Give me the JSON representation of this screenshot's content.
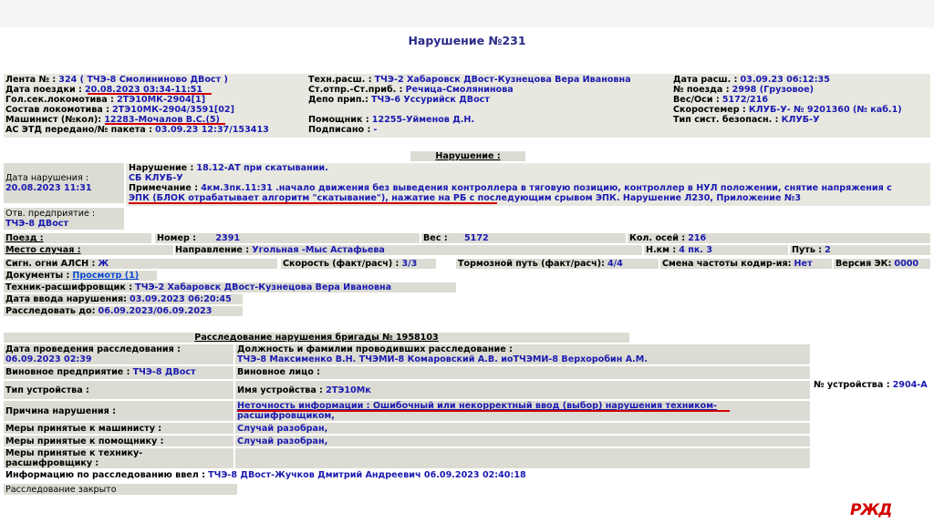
{
  "title": "Нарушение №231",
  "info": {
    "lenta_label": "Лента № :",
    "lenta_value": "324 ( ТЧЭ-8 Смолининово ДВост )",
    "trip_date_label": "Дата поездки :",
    "trip_date_value": "20.08.2023 03:34-11:51",
    "lead_loco_label": "Гол.сек.локомотива :",
    "lead_loco_value": "2ТЭ10МК-2904[1]",
    "loco_comp_label": "Состав локомотива :",
    "loco_comp_value": "2ТЭ10МК-2904/3591[02]",
    "driver_label": "Машинист (№кол):",
    "driver_value": "12283-Мочалов В.С.(5)",
    "asetd_label": "АС ЭТД передано/№ пакета :",
    "asetd_value": "03.09.23 12:37/153413",
    "tech_label": "Техн.расш. :",
    "tech_value": "ТЧЭ-2 Хабаровск ДВост-Кузнецова Вера Ивановна",
    "stations_label": "Ст.отпр.-Ст.приб. :",
    "stations_value": "Речица-Смолянинова",
    "depot_label": "Депо прип.:",
    "depot_value": "ТЧЭ-6 Уссурийск ДВост",
    "assistant_label": "Помощник :",
    "assistant_value": "12255-Уйменов Д.Н.",
    "signed_label": "Подписано :",
    "signed_value": "-",
    "decode_date_label": "Дата расш. :",
    "decode_date_value": "03.09.23 06:12:35",
    "train_no_label": "№ поезда :",
    "train_no_value": "2998 (Грузовое)",
    "weight_label": "Вес/Оси :",
    "weight_value": "5172/216",
    "speedometer_label": "Скоростемер :",
    "speedometer_value": "КЛУБ-У- № 9201360 (№ каб.1)",
    "safety_label": "Тип сист. безопасн. :",
    "safety_value": "КЛУБ-У"
  },
  "violation": {
    "section_header": "Нарушение :",
    "date_label": "Дата нарушения :",
    "date_value": "20.08.2023 11:31",
    "resp_label": "Отв. предприятие :",
    "resp_value": "ТЧЭ-8 ДВост",
    "name_label": "Нарушение :",
    "name_value": "18.12-АТ при скатывании.",
    "system_value": "СБ КЛУБ-У",
    "note_label": "Примечание :",
    "note_value_1": "4км.3пк.11:31 .начало движения без выведения контроллера в тяговую позицию, контроллер в НУЛ положении, снятие напряжения с",
    "note_value_2": "ЭПК (БЛОК отрабатывает алгоритм \"скатывание\"), нажатие на РБ с последующим срывом ЭПК. Нарушение Л230, Приложение №3"
  },
  "train": {
    "train_label": "Поезд :",
    "number_label": "Номер :",
    "number_value": "2391",
    "weight_label": "Вес :",
    "weight_value": "5172",
    "axles_label": "Кол. осей :",
    "axles_value": "216",
    "place_label": "Место случая :",
    "direction_label": "Направление :",
    "direction_value": "Угольная -Мыс Астафьева",
    "km_label": "Н.км :",
    "km_value": "4 пк. 3",
    "track_label": "Путь :",
    "track_value": "2",
    "alsn_label": "Сигн. огни АЛСН :",
    "alsn_value": "Ж",
    "speed_label": "Скорость (факт/расч) :",
    "speed_value": "3/3",
    "brake_label": "Тормозной путь (факт/расч):",
    "brake_value": "4/4",
    "freq_label": "Смена частоты кодир-ия:",
    "freq_value": "Нет",
    "version_label": "Версия ЭК:",
    "version_value": "0000",
    "docs_label": "Документы :",
    "docs_link": "Просмотр (1)",
    "decoder_label": "Техник-расшифровщик :",
    "decoder_value": "ТЧЭ-2 Хабаровск ДВост-Кузнецова Вера Ивановна",
    "entry_label": "Дата ввода нарушения:",
    "entry_value": "03.09.2023 06:20:45",
    "investigate_label": "Расследовать до:",
    "investigate_value": "06.09.2023/06.09.2023"
  },
  "investigation": {
    "section_header": "Расследование нарушения бригады № 1958103",
    "date_label": "Дата проведения расследования :",
    "date_value": "06.09.2023  02:39",
    "positions_label": "Должность и фамилии проводивших расследование :",
    "positions_value": "ТЧЭ-8 Максименко В.Н. ТЧЭМИ-8 Комаровский А.В. иоТЧЭМИ-8 Верхоробин А.М.",
    "guilty_ent_label": "Виновное предприятие :",
    "guilty_ent_value": "ТЧЭ-8 ДВост",
    "guilty_person_label": "Виновное лицо :",
    "device_type_label": "Тип устройства :",
    "device_name_label": "Имя устройства :",
    "device_name_value": "2ТЭ10Мк",
    "device_no_label": "№ устройства :",
    "device_no_value": "2904-А",
    "cause_label": "Причина нарушения :",
    "cause_value_1": "Неточность информации : Ошибочный или некорректный ввод (выбор) нарушения техником-",
    "cause_value_2": "расшифровщиком,",
    "measures_driver_label": "Меры принятые к машинисту :",
    "measures_driver_value": "Случай разобран,",
    "measures_assistant_label": "Меры принятые к помощнику :",
    "measures_assistant_value": "Случай разобран,",
    "measures_tech_label_1": "Меры принятые к технику-",
    "measures_tech_label_2": "расшифровщику :",
    "info_label": "Информацию по расследованию ввел :",
    "info_value": "ТЧЭ-8 ДВост-Жучков Дмитрий Андреевич 06.09.2023 02:40:18",
    "closed_label": "Расследование закрыто"
  },
  "logo_text": "РЖД",
  "colors": {
    "label_bg": "#dcdcd4",
    "value_blue": "#1a1ab0",
    "underline_red": "#d40000",
    "title_blue": "#2a2a8a"
  }
}
